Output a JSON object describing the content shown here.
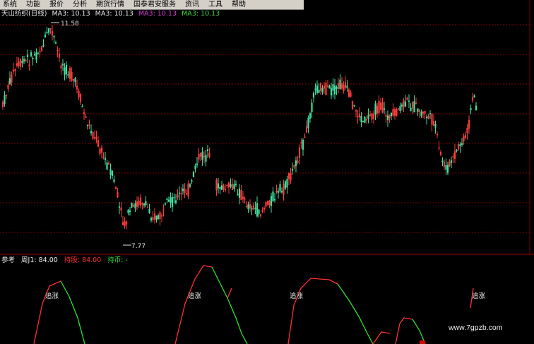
{
  "menu": {
    "items": [
      "系统",
      "功能",
      "报价",
      "分析",
      "期货行情",
      "国泰君安服务",
      "资讯",
      "工具",
      "帮助"
    ]
  },
  "price_panel": {
    "stock_title": "天山纺织(日线)",
    "ma_labels": [
      "MA3: 10.13",
      "MA3: 10.13",
      "MA3: 10.13",
      "MA3: 10.13"
    ],
    "ma_colors": [
      "#e0e0e0",
      "#e0e0e0",
      "#d040d0",
      "#40d040"
    ],
    "high_label": "11.58",
    "low_label": "7.77"
  },
  "indicator_panel": {
    "name": "参考",
    "j1_label": "周J1: 84.00",
    "stock_hold_label": "持股: 84.00",
    "coin_hold_label": "持币: -",
    "signal_label": "追涨"
  },
  "watermark": "www.7gpzb.com",
  "colors": {
    "up": "#ff3c3c",
    "down": "#40e0a0",
    "grid": "#7a0000",
    "indicator_red": "#ff3030",
    "indicator_green": "#30e030"
  }
}
